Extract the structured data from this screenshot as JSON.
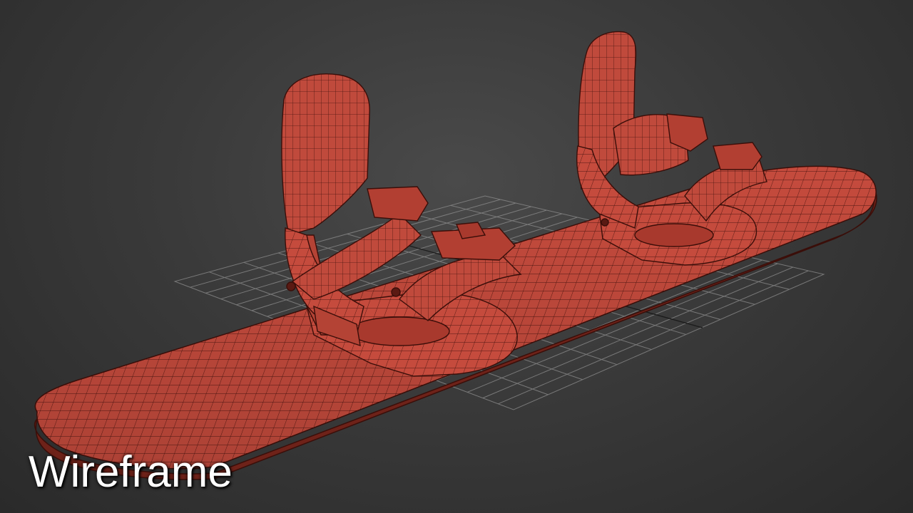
{
  "viewport": {
    "background_color": "#3a3a3a",
    "model_color": "#c14a3c",
    "wire_color": "#4a1510",
    "grid_color": "#8a8a8a",
    "object": "snowboard-with-bindings-wireframe"
  },
  "label": {
    "text": "Wireframe"
  }
}
